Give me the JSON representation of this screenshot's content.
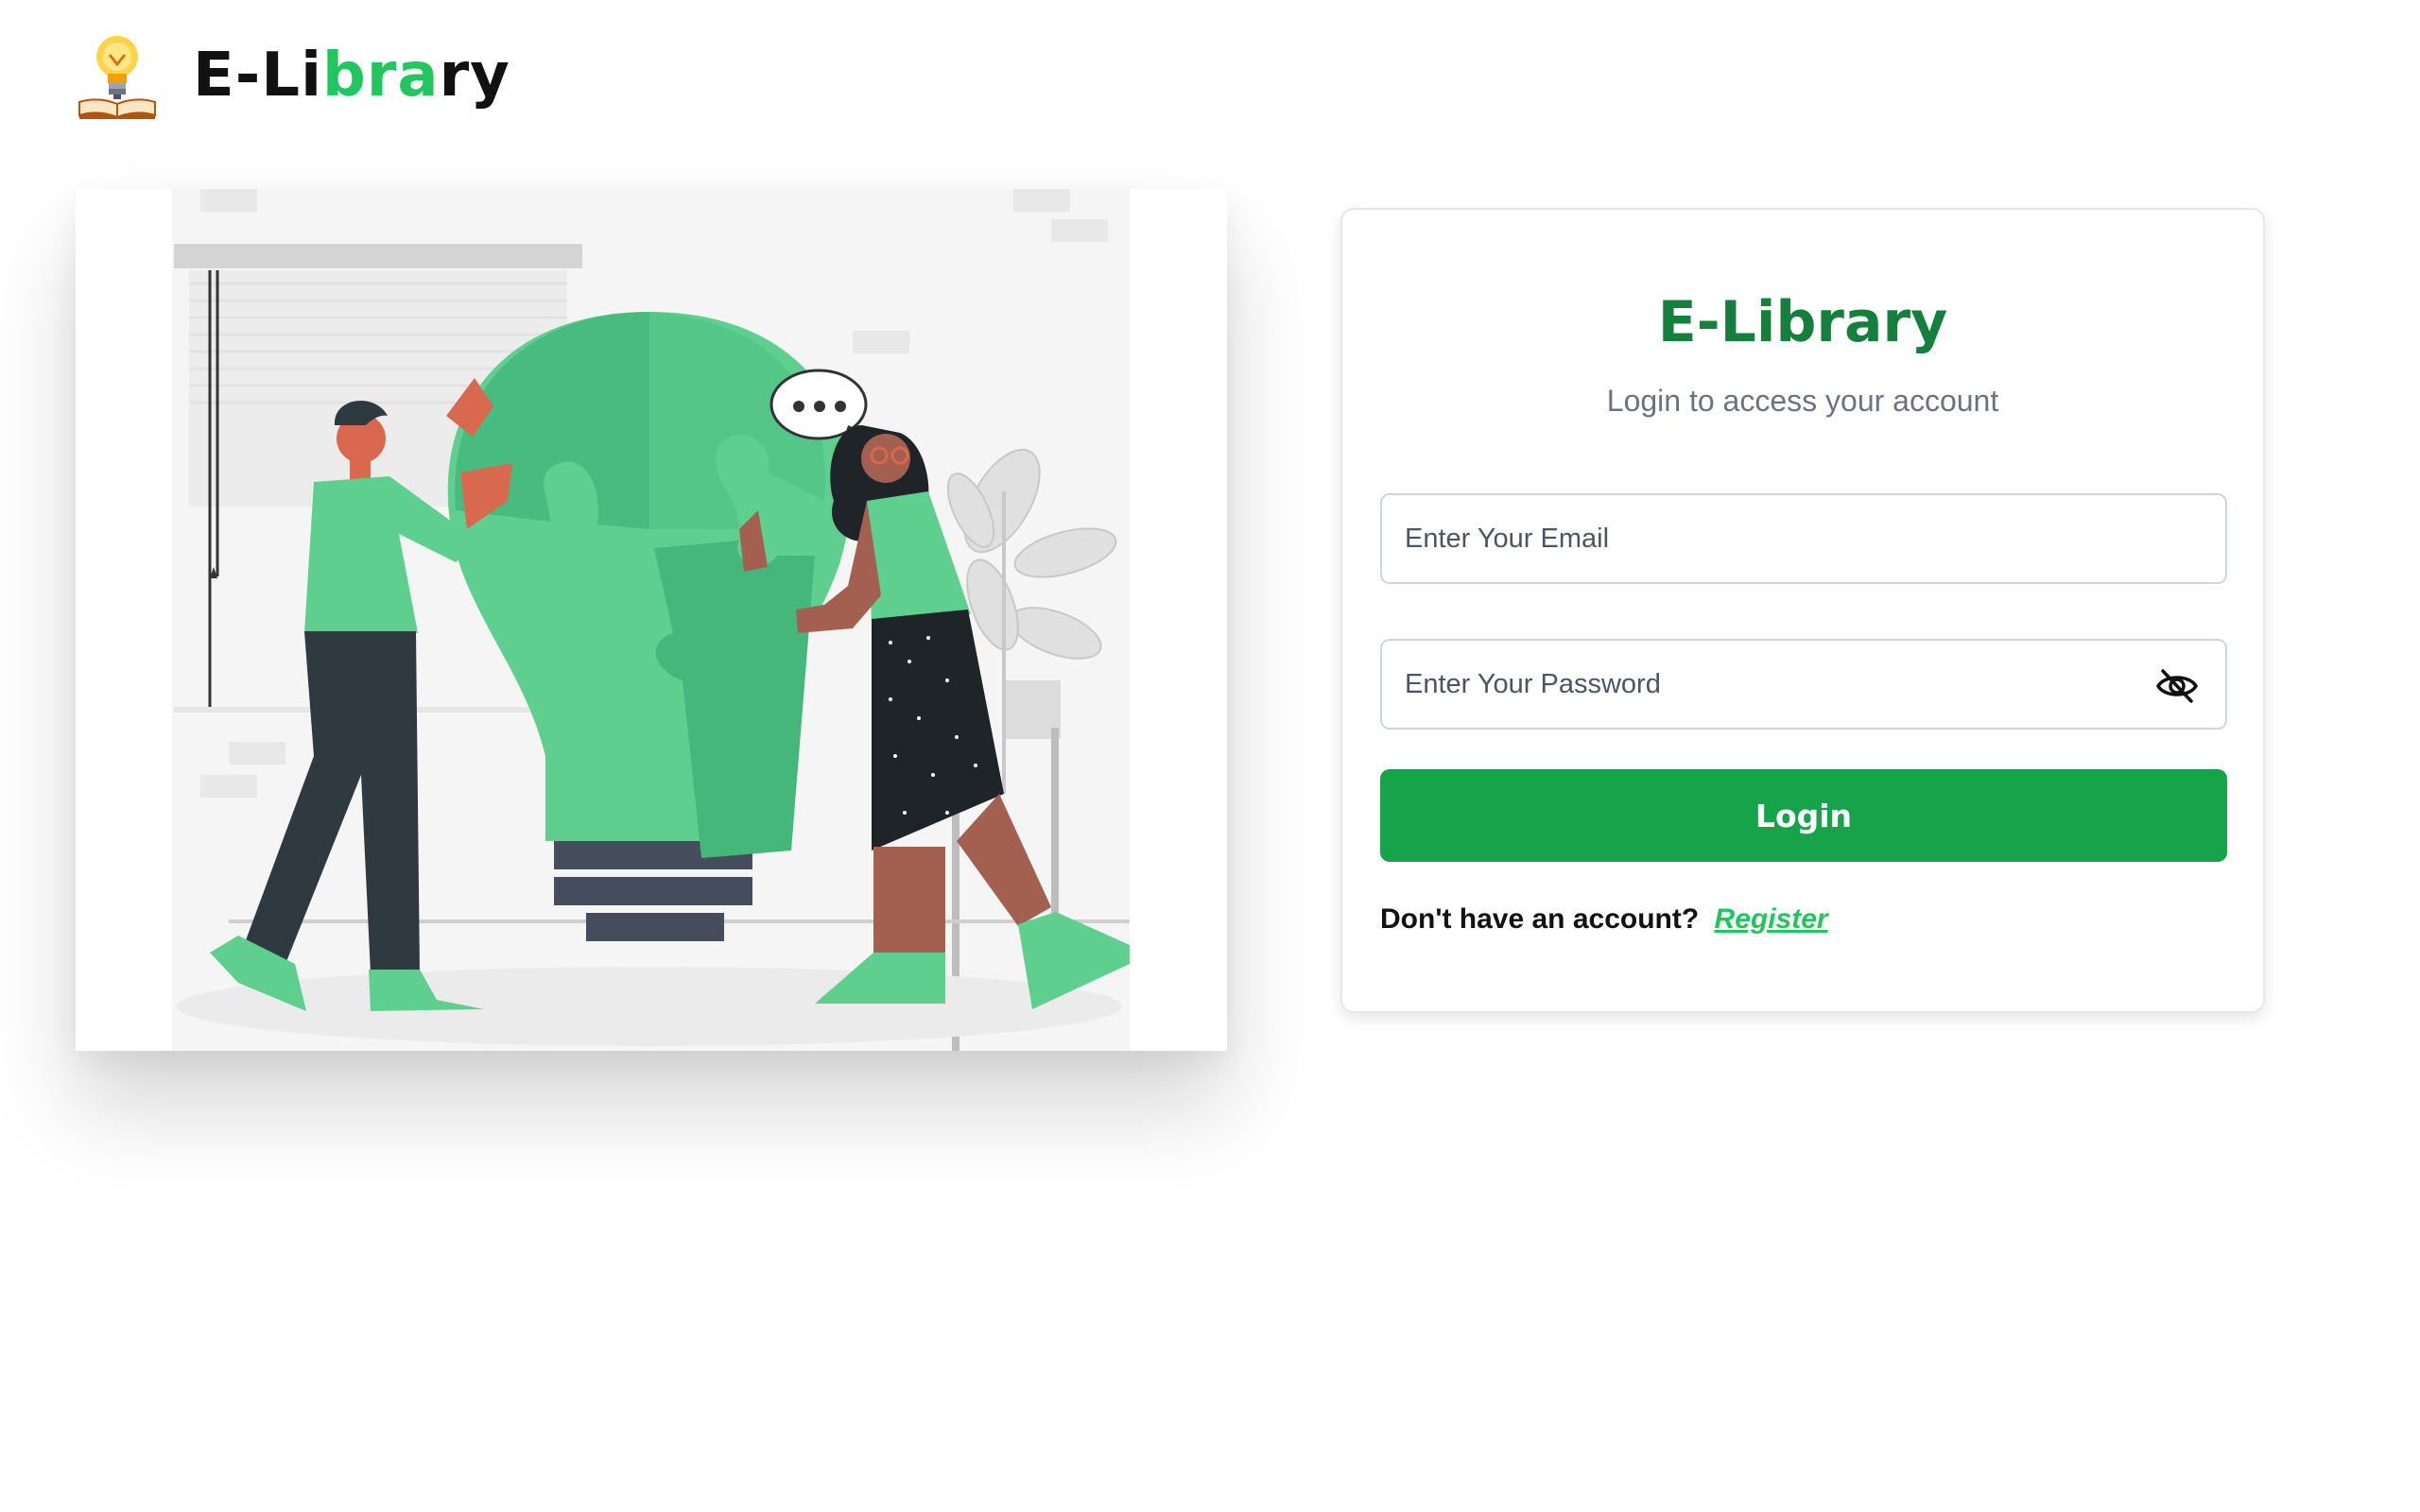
{
  "header": {
    "brand_part1": "E-Li",
    "brand_part2": "bra",
    "brand_part3": "ry",
    "logo_icon": "lightbulb-book-icon"
  },
  "hero": {
    "illustration": "people-assembling-lightbulb-puzzle",
    "bubble_text": "•••"
  },
  "login": {
    "title": "E-Library",
    "subtitle": "Login to access your account",
    "email_placeholder": "Enter Your Email",
    "password_placeholder": "Enter Your Password",
    "password_toggle_icon": "eye-slash-icon",
    "submit_label": "Login",
    "no_account_text": "Don't have an account?",
    "register_label": "Register"
  },
  "colors": {
    "accent": "#22c55e",
    "button": "#16a34a",
    "title": "#15803d",
    "subtitle": "#6b7280"
  }
}
